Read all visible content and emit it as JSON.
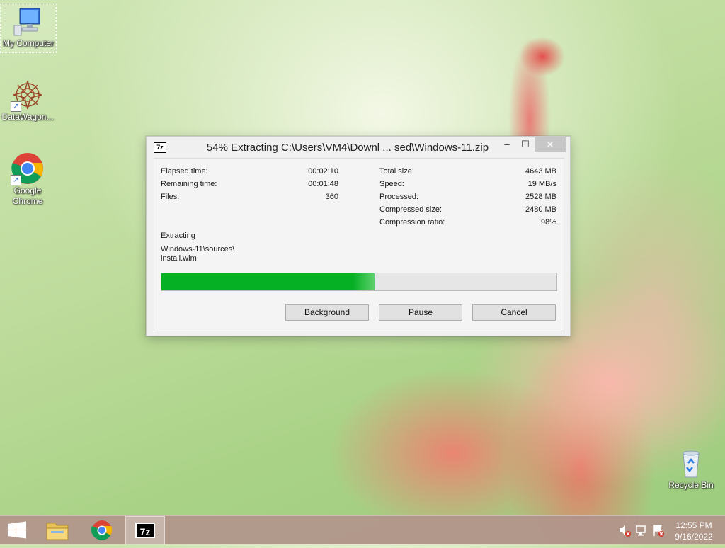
{
  "desktop": {
    "icons": [
      {
        "label": "My Computer"
      },
      {
        "label": "DataWagon..."
      },
      {
        "label": "Google Chrome"
      },
      {
        "label": "Recycle Bin"
      }
    ]
  },
  "dialog": {
    "app_icon": "7z",
    "title": "54% Extracting C:\\Users\\VM4\\Downl ... sed\\Windows-11.zip",
    "window_buttons": {
      "minimize": "–",
      "maximize": "☐",
      "close": "✕"
    },
    "left_stats": [
      {
        "label": "Elapsed time:",
        "value": "00:02:10"
      },
      {
        "label": "Remaining time:",
        "value": "00:01:48"
      },
      {
        "label": "Files:",
        "value": "360"
      }
    ],
    "right_stats": [
      {
        "label": "Total size:",
        "value": "4643 MB"
      },
      {
        "label": "Speed:",
        "value": "19 MB/s"
      },
      {
        "label": "Processed:",
        "value": "2528 MB"
      },
      {
        "label": "Compressed size:",
        "value": "2480 MB"
      },
      {
        "label": "Compression ratio:",
        "value": "98%"
      }
    ],
    "status_label": "Extracting",
    "current_path_line1": "Windows-11\\sources\\",
    "current_path_line2": "install.wim",
    "progress_percent": 54,
    "buttons": {
      "background": "Background",
      "pause": "Pause",
      "cancel": "Cancel"
    }
  },
  "taskbar": {
    "apps": [
      {
        "icon": "start-windows-icon"
      },
      {
        "icon": "file-explorer-icon"
      },
      {
        "icon": "chrome-icon"
      },
      {
        "icon": "7zip-icon",
        "label": "7z",
        "active": true
      }
    ],
    "tray_icons": [
      "volume-muted-icon",
      "network-icon",
      "action-center-icon"
    ],
    "clock": {
      "time": "12:55 PM",
      "date": "9/16/2022"
    }
  },
  "colors": {
    "progress_fill": "#06b025",
    "taskbar": "#b2948c"
  }
}
